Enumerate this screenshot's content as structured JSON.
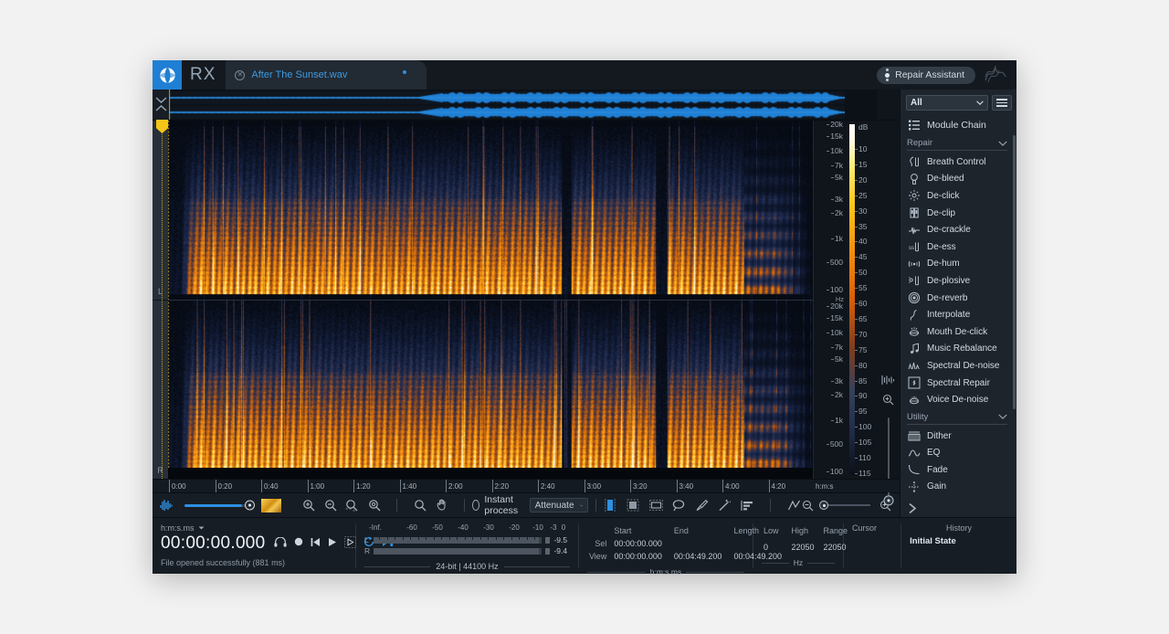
{
  "titlebar": {
    "brand": "RX",
    "tab_title": "After The Sunset.wav",
    "repair_assistant": "Repair Assistant"
  },
  "module_panel": {
    "filter_value": "All",
    "chain_label": "Module Chain",
    "groups": [
      {
        "name": "Repair",
        "items": [
          {
            "label": "Breath Control",
            "icon": "breath-icon"
          },
          {
            "label": "De-bleed",
            "icon": "debleed-icon"
          },
          {
            "label": "De-click",
            "icon": "declick-icon"
          },
          {
            "label": "De-clip",
            "icon": "declip-icon"
          },
          {
            "label": "De-crackle",
            "icon": "decrackle-icon"
          },
          {
            "label": "De-ess",
            "icon": "deess-icon"
          },
          {
            "label": "De-hum",
            "icon": "dehum-icon"
          },
          {
            "label": "De-plosive",
            "icon": "deplosive-icon"
          },
          {
            "label": "De-reverb",
            "icon": "dereverb-icon"
          },
          {
            "label": "Interpolate",
            "icon": "interpolate-icon"
          },
          {
            "label": "Mouth De-click",
            "icon": "mouth-declick-icon"
          },
          {
            "label": "Music Rebalance",
            "icon": "music-rebalance-icon"
          },
          {
            "label": "Spectral De-noise",
            "icon": "spectral-denoise-icon"
          },
          {
            "label": "Spectral Repair",
            "icon": "spectral-repair-icon"
          },
          {
            "label": "Voice De-noise",
            "icon": "voice-denoise-icon"
          }
        ]
      },
      {
        "name": "Utility",
        "items": [
          {
            "label": "Dither",
            "icon": "dither-icon"
          },
          {
            "label": "EQ",
            "icon": "eq-icon"
          },
          {
            "label": "Fade",
            "icon": "fade-icon"
          },
          {
            "label": "Gain",
            "icon": "gain-icon"
          }
        ]
      }
    ]
  },
  "spectrogram": {
    "channels": [
      "L",
      "R"
    ],
    "freq_ticks": [
      "20k",
      "15k",
      "10k",
      "7k",
      "5k",
      "3k",
      "2k",
      "1k",
      "500",
      "100"
    ],
    "freq_unit": "Hz",
    "db_header": "dB",
    "db_ticks": [
      "10",
      "15",
      "20",
      "25",
      "30",
      "35",
      "40",
      "45",
      "50",
      "55",
      "60",
      "65",
      "70",
      "75",
      "80",
      "85",
      "90",
      "95",
      "100",
      "105",
      "110",
      "115"
    ],
    "time_ticks": [
      "0:00",
      "0:20",
      "0:40",
      "1:00",
      "1:20",
      "1:40",
      "2:00",
      "2:20",
      "2:40",
      "3:00",
      "3:20",
      "3:40",
      "4:00",
      "4:20"
    ],
    "time_unit": "h:m:s"
  },
  "toolbar": {
    "instant_process": "Instant process",
    "process_mode": "Attenuate"
  },
  "bottom": {
    "time_format": "h:m:s.ms",
    "timecode": "00:00:00.000",
    "status": "File opened successfully (881 ms)",
    "meter": {
      "scale": [
        "-Inf.",
        "-60",
        "-50",
        "-40",
        "-30",
        "-20",
        "-10",
        "-3",
        "0"
      ],
      "rows": [
        {
          "label": "L",
          "value": "-9.5"
        },
        {
          "label": "R",
          "value": "-9.4"
        }
      ],
      "format": "24-bit | 44100 Hz"
    },
    "time_table": {
      "headers": [
        "Start",
        "End",
        "Length"
      ],
      "rows": [
        {
          "label": "Sel",
          "start": "00:00:00.000",
          "end": "",
          "length": ""
        },
        {
          "label": "View",
          "start": "00:00:00.000",
          "end": "00:04:49.200",
          "length": "00:04:49.200"
        }
      ],
      "unit": "h:m:s.ms"
    },
    "freq_table": {
      "headers": [
        "Low",
        "High",
        "Range",
        "Cursor"
      ],
      "values": [
        "0",
        "22050",
        "22050",
        ""
      ],
      "unit": "Hz"
    },
    "history": {
      "title": "History",
      "items": [
        "Initial State"
      ]
    }
  },
  "colors": {
    "accent": "#2f8fe0",
    "panel": "#1e242c",
    "background": "#1b2026",
    "spectro_hot": "#ff9a1f",
    "playhead": "#f5c518"
  }
}
